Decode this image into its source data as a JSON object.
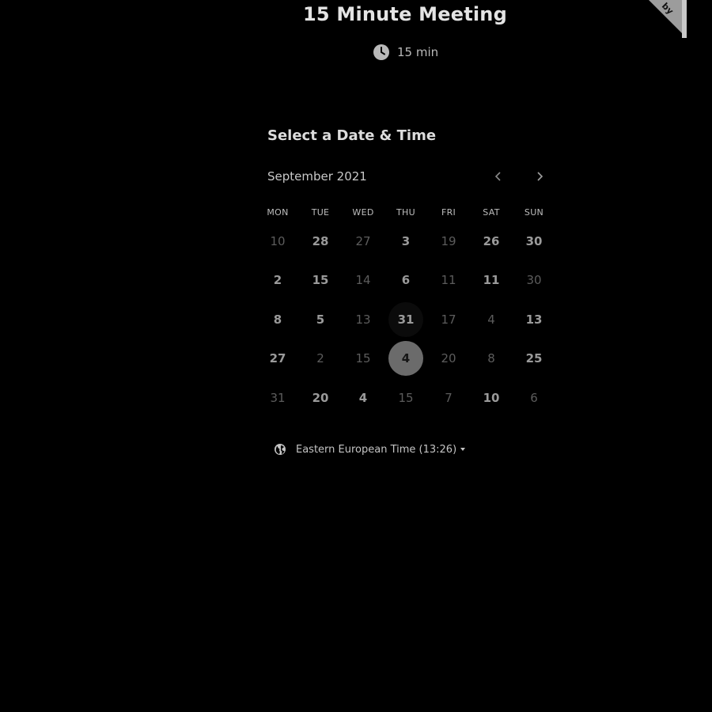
{
  "meeting": {
    "title": "15 Minute Meeting",
    "duration_icon": "clock-icon",
    "duration": "15 min"
  },
  "ribbon": {
    "label": "by"
  },
  "calendar": {
    "heading": "Select a Date & Time",
    "month": "September 2021",
    "prev_icon": "chevron-left-icon",
    "next_icon": "chevron-right-icon",
    "weekdays": [
      "MON",
      "TUE",
      "WED",
      "THU",
      "FRI",
      "SAT",
      "SUN"
    ],
    "days": [
      {
        "label": "10",
        "available": false
      },
      {
        "label": "28",
        "available": true
      },
      {
        "label": "27",
        "available": false
      },
      {
        "label": "3",
        "available": true
      },
      {
        "label": "19",
        "available": false
      },
      {
        "label": "26",
        "available": true
      },
      {
        "label": "30",
        "available": true
      },
      {
        "label": "2",
        "available": true
      },
      {
        "label": "15",
        "available": true
      },
      {
        "label": "14",
        "available": false
      },
      {
        "label": "6",
        "available": true
      },
      {
        "label": "11",
        "available": false
      },
      {
        "label": "11",
        "available": true
      },
      {
        "label": "30",
        "available": false
      },
      {
        "label": "8",
        "available": true
      },
      {
        "label": "5",
        "available": true
      },
      {
        "label": "13",
        "available": false
      },
      {
        "label": "31",
        "available": true,
        "hovered": true
      },
      {
        "label": "17",
        "available": false
      },
      {
        "label": "4",
        "available": false
      },
      {
        "label": "13",
        "available": true
      },
      {
        "label": "27",
        "available": true
      },
      {
        "label": "2",
        "available": false
      },
      {
        "label": "15",
        "available": false
      },
      {
        "label": "4",
        "available": true,
        "selected": true
      },
      {
        "label": "20",
        "available": false
      },
      {
        "label": "8",
        "available": false
      },
      {
        "label": "25",
        "available": true
      },
      {
        "label": "31",
        "available": false
      },
      {
        "label": "20",
        "available": true
      },
      {
        "label": "4",
        "available": true
      },
      {
        "label": "15",
        "available": false
      },
      {
        "label": "7",
        "available": false
      },
      {
        "label": "10",
        "available": true
      },
      {
        "label": "6",
        "available": false
      }
    ]
  },
  "timezone": {
    "icon": "globe-icon",
    "label": "Eastern European Time (13:26)"
  }
}
